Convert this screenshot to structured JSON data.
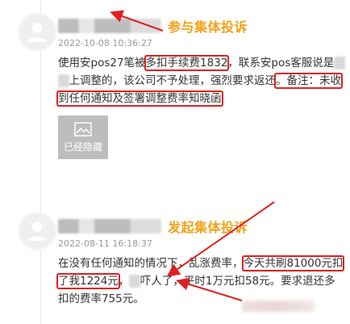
{
  "posts": [
    {
      "user": "",
      "action": "参与集体投诉",
      "timestamp": "2022-10-08 10:36:27",
      "content": {
        "p1": "使用安pos27笔被",
        "hl1": "多扣手续费1832",
        "p2": "，联系安pos客服说是",
        "blur1": "通道",
        "p3": "上调整的，该公司不予处理，强烈要求返还",
        "hl2": "。备注：未收到任何通知及签署调整费率知晓函"
      },
      "hidden_label": "已经隐藏",
      "icons": {
        "hidden_image": "image-icon",
        "avatar": "avatar-icon"
      }
    },
    {
      "user": "",
      "action": "发起集体投诉",
      "timestamp": "2022-08-11 16:18:37",
      "content": {
        "p1": "在没有任何通知的情况下，乱涨费率，",
        "hl1": "今天共刷81000元扣了我1224元",
        "p2": "，",
        "blur1": "太",
        "p3": "吓人了，平时1万元扣58元。要求退还多扣的费率755元。"
      },
      "icons": {
        "avatar": "avatar-icon"
      }
    }
  ],
  "colors": {
    "accent": "#f3a118",
    "highlight": "#e02020"
  }
}
